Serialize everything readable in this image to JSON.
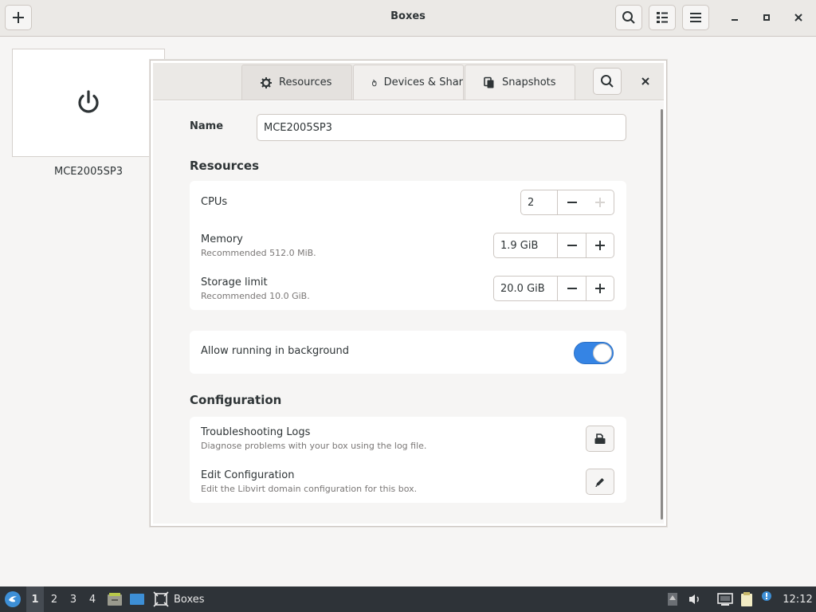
{
  "app": {
    "title": "Boxes",
    "buttons": {
      "new": "new-box",
      "search": "search",
      "view": "list-view",
      "menu": "main-menu"
    }
  },
  "collection": {
    "box_name": "MCE2005SP3"
  },
  "preferences": {
    "tabs": [
      {
        "label": "Resources",
        "icon": "gear-icon"
      },
      {
        "label": "Devices & Shar",
        "icon": "mouse-icon"
      },
      {
        "label": "Snapshots",
        "icon": "snapshots-icon"
      }
    ],
    "name_label": "Name",
    "name_value": "MCE2005SP3",
    "resources_title": "Resources",
    "cpus": {
      "label": "CPUs",
      "value": "2"
    },
    "memory": {
      "label": "Memory",
      "sub": "Recommended 512.0 MiB.",
      "value": "1.9 GiB"
    },
    "storage": {
      "label": "Storage limit",
      "sub": "Recommended 10.0 GiB.",
      "value": "20.0 GiB"
    },
    "background": {
      "label": "Allow running in background",
      "enabled": true
    },
    "configuration_title": "Configuration",
    "logs": {
      "label": "Troubleshooting Logs",
      "sub": "Diagnose problems with your box using the log file."
    },
    "edit_config": {
      "label": "Edit Configuration",
      "sub": "Edit the Libvirt domain configuration for this box."
    }
  },
  "taskbar": {
    "workspaces": [
      "1",
      "2",
      "3",
      "4"
    ],
    "active_workspace": "1",
    "task_label": "Boxes",
    "clock": "12:12"
  },
  "colors": {
    "accent": "#3584e4",
    "taskbar": "#2e3338"
  }
}
